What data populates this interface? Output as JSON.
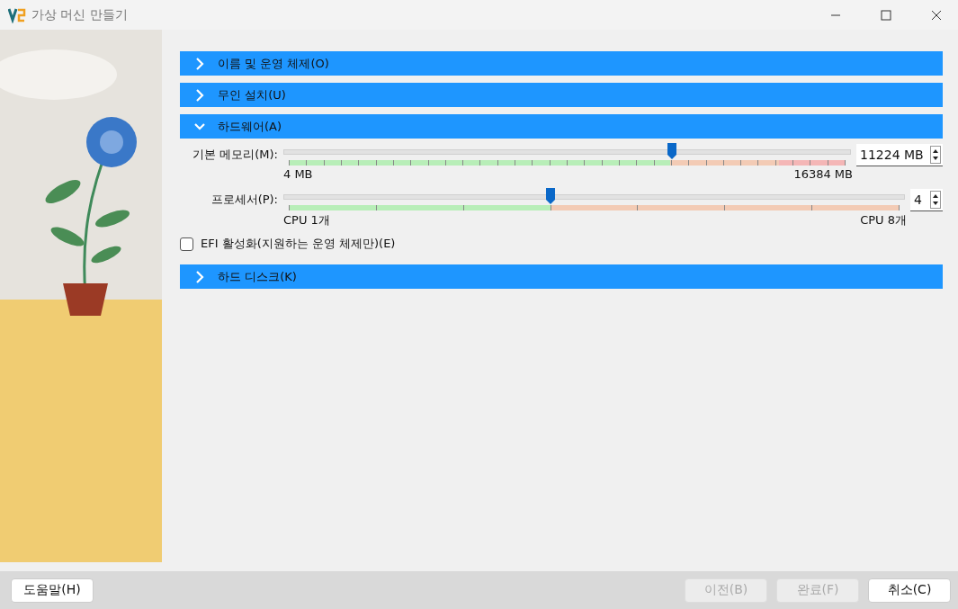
{
  "window": {
    "title": "가상 머신 만들기"
  },
  "sections": [
    {
      "title": "이름 및 운영 체제(O)",
      "expanded": false
    },
    {
      "title": "무인 설치(U)",
      "expanded": false
    },
    {
      "title": "하드웨어(A)",
      "expanded": true
    },
    {
      "title": "하드 디스크(K)",
      "expanded": false
    }
  ],
  "hardware": {
    "sliders": [
      {
        "kind": "memory",
        "label": "기본 메모리(M):",
        "level": 0.685,
        "value": "11224 MB",
        "min_label": "4 MB",
        "max_label": "16384 MB"
      },
      {
        "kind": "cpu",
        "label": "프로세서(P):",
        "level": 0.43,
        "value": "4",
        "min_label": "CPU 1개",
        "max_label": "CPU 8개"
      }
    ],
    "efi": {
      "label": "EFI 활성화(지원하는 운영 체제만)(E)",
      "checked": false
    }
  },
  "buttons": [
    {
      "label": "도움말(H)",
      "disabled": false
    },
    {
      "label": "이전(B)",
      "disabled": true
    },
    {
      "label": "완료(F)",
      "disabled": true
    },
    {
      "label": "취소(C)",
      "disabled": false
    }
  ]
}
